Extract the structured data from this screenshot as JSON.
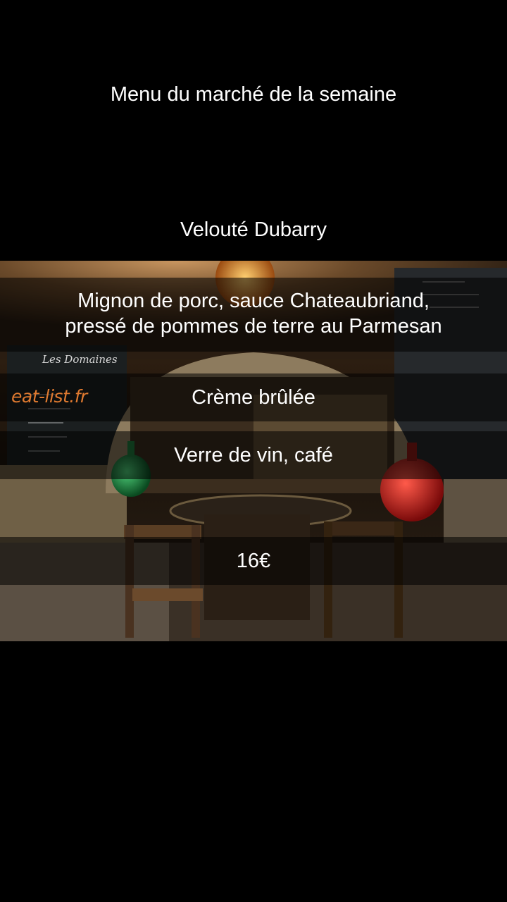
{
  "title": "Menu du marché de la semaine",
  "menu": {
    "starter": "Velouté Dubarry",
    "main_line1": "Mignon de porc, sauce Chateaubriand,",
    "main_line2": "pressé de pommes de terre au Parmesan",
    "dessert": "Crème brûlée",
    "drink": "Verre de vin, café",
    "price": "16€"
  },
  "photo": {
    "watermark": "eat-list.fr",
    "board_text": "Les Domaines",
    "icons": [
      "pendant-lamp-icon",
      "green-demijohn-icon",
      "red-demijohn-icon",
      "round-table-icon",
      "chair-icon"
    ]
  },
  "colors": {
    "background": "#000000",
    "text": "#ffffff",
    "watermark": "#e07a30",
    "band": "rgba(0,0,0,0.55)"
  }
}
